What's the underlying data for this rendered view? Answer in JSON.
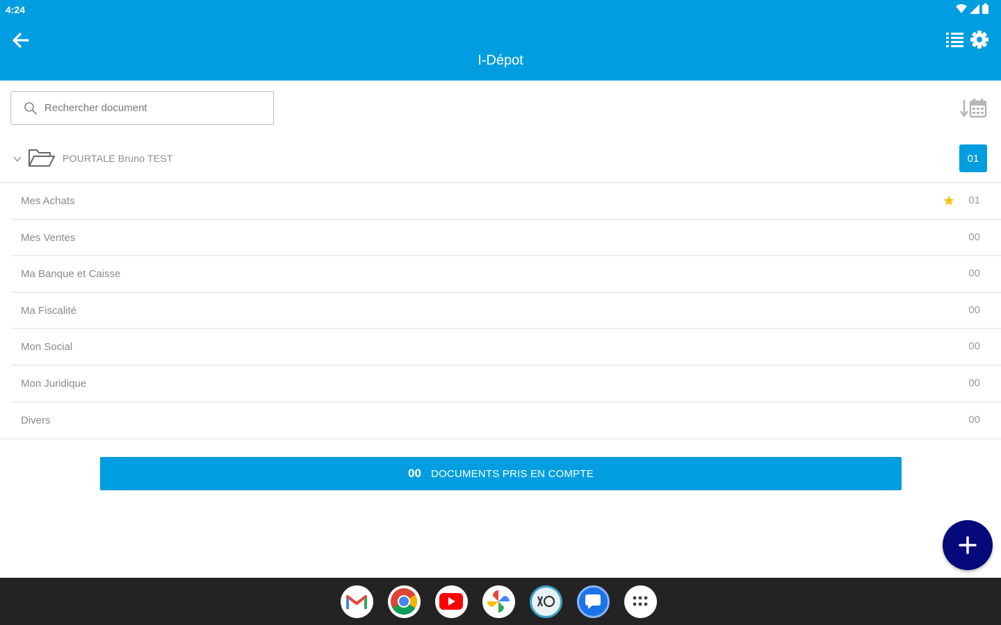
{
  "status_bar": {
    "time": "4:24"
  },
  "app_bar": {
    "title": "I-Dépot"
  },
  "search": {
    "placeholder": "Rechercher document"
  },
  "folder": {
    "name": "POURTALE Bruno TEST",
    "count": "01"
  },
  "categories": [
    {
      "label": "Mes Achats",
      "count": "01",
      "starred": true
    },
    {
      "label": "Mes Ventes",
      "count": "00"
    },
    {
      "label": "Ma Banque et Caisse",
      "count": "00"
    },
    {
      "label": "Ma Fiscalité",
      "count": "00"
    },
    {
      "label": "Mon Social",
      "count": "00"
    },
    {
      "label": "Mon Juridique",
      "count": "00"
    },
    {
      "label": "Divers",
      "count": "00"
    }
  ],
  "documents_bar": {
    "count": "00",
    "label": "DOCUMENTS PRIS EN COMPTE"
  },
  "taskbar": {
    "apps": [
      "gmail-icon",
      "chrome-icon",
      "youtube-icon",
      "photos-icon",
      "idepot-icon",
      "messages-icon",
      "app-drawer-icon"
    ]
  },
  "colors": {
    "primary": "#009ee0",
    "fab": "#06097a",
    "star": "#f5c518",
    "taskbar": "#232323"
  }
}
